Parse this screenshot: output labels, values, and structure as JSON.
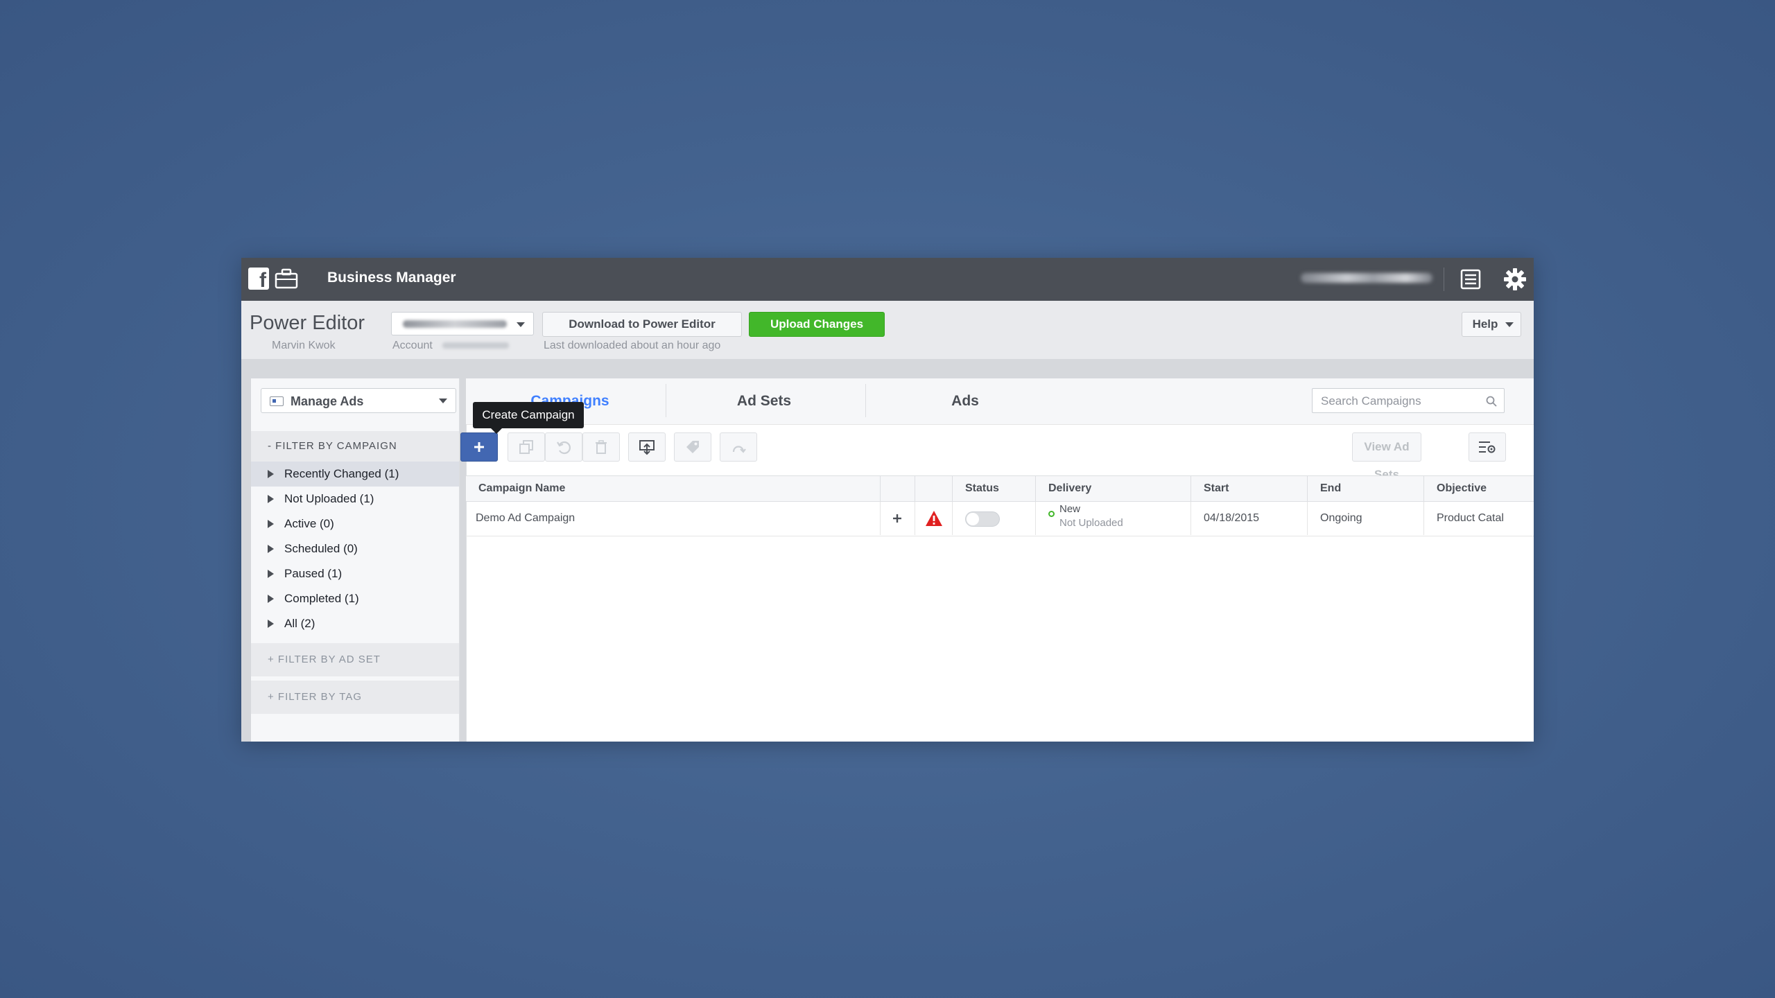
{
  "topbar": {
    "title": "Business Manager",
    "icons": [
      "facebook-logo-icon",
      "briefcase-icon",
      "list-icon",
      "gear-icon"
    ]
  },
  "header": {
    "title": "Power Editor",
    "user": "Marvin Kwok",
    "account_label": "Account",
    "download_button": "Download to Power Editor",
    "upload_button": "Upload Changes",
    "last_downloaded": "Last downloaded about an hour ago",
    "help_button": "Help"
  },
  "sidebar": {
    "manage_ads": "Manage Ads",
    "filter_by_campaign": "- FILTER BY CAMPAIGN",
    "items": [
      {
        "label": "Recently Changed (1)"
      },
      {
        "label": "Not Uploaded (1)"
      },
      {
        "label": "Active (0)"
      },
      {
        "label": "Scheduled (0)"
      },
      {
        "label": "Paused (1)"
      },
      {
        "label": "Completed (1)"
      },
      {
        "label": "All (2)"
      }
    ],
    "filter_by_ad_set": "+ FILTER BY AD SET",
    "filter_by_tag": "+ FILTER BY TAG"
  },
  "tabs": [
    {
      "label": "Campaigns"
    },
    {
      "label": "Ad Sets"
    },
    {
      "label": "Ads"
    }
  ],
  "search": {
    "placeholder": "Search Campaigns"
  },
  "toolbar": {
    "tooltip": "Create Campaign",
    "view_ad_sets": "View Ad Sets"
  },
  "table": {
    "columns": [
      "Campaign Name",
      "",
      "",
      "Status",
      "Delivery",
      "Start",
      "End",
      "Objective"
    ],
    "rows": [
      {
        "campaign_name": "Demo Ad Campaign",
        "status_on": false,
        "delivery": "New",
        "delivery_sub": "Not Uploaded",
        "start": "04/18/2015",
        "end": "Ongoing",
        "objective": "Product Catal"
      }
    ]
  },
  "colors": {
    "topbar": "#4b4f56",
    "accent_blue": "#4267b2",
    "active_tab": "#4080ff",
    "upload_green": "#42b72a",
    "warning_red": "#e02020"
  }
}
